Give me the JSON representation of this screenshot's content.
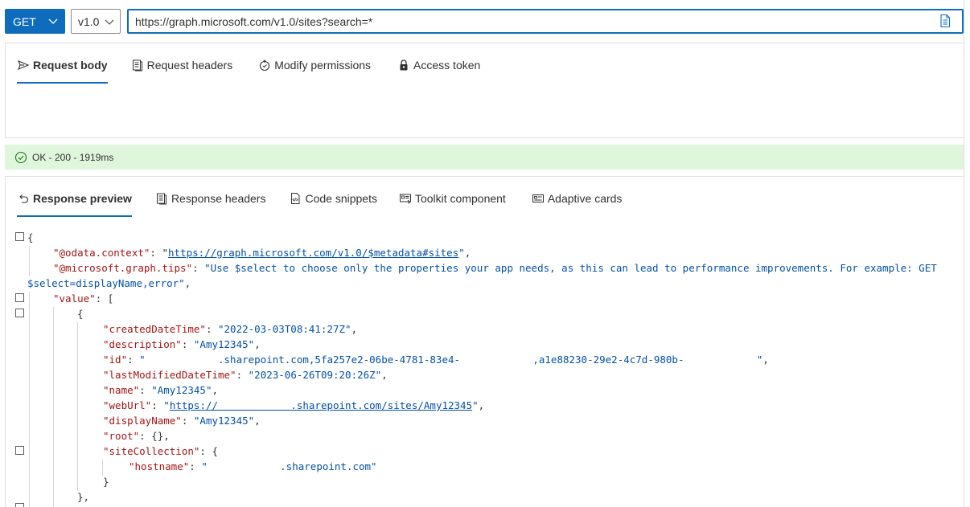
{
  "query": {
    "method": "GET",
    "version": "v1.0",
    "url": "https://graph.microsoft.com/v1.0/sites?search=*"
  },
  "request_tabs": [
    {
      "label": "Request body",
      "icon": "send-icon",
      "active": true
    },
    {
      "label": "Request headers",
      "icon": "headers-icon",
      "active": false
    },
    {
      "label": "Modify permissions",
      "icon": "shield-icon",
      "active": false
    },
    {
      "label": "Access token",
      "icon": "lock-icon",
      "active": false
    }
  ],
  "status": {
    "text": "OK - 200 - 1919ms",
    "color": "#dff6dd"
  },
  "response_tabs": [
    {
      "label": "Response preview",
      "icon": "undo-arrow-icon",
      "active": true
    },
    {
      "label": "Response headers",
      "icon": "headers-icon",
      "active": false
    },
    {
      "label": "Code snippets",
      "icon": "code-file-icon",
      "active": false
    },
    {
      "label": "Toolkit component",
      "icon": "toolkit-icon",
      "active": false
    },
    {
      "label": "Adaptive cards",
      "icon": "card-icon",
      "active": false
    }
  ],
  "json": {
    "open_brace": "{",
    "odata_context_key": "\"@odata.context\"",
    "odata_context_val": "https://graph.microsoft.com/v1.0/$metadata#sites",
    "tips_key": "\"@microsoft.graph.tips\"",
    "tips_val_1": "\"Use $select to choose only the properties your app needs, as this can lead to performance improvements. For example: GET",
    "tips_val_2": "$select=displayName,error\"",
    "value_key": "\"value\"",
    "item_open": "{",
    "createdDateTime_key": "\"createdDateTime\"",
    "createdDateTime_val": "\"2022-03-03T08:41:27Z\"",
    "description_key": "\"description\"",
    "description_val": "\"Amy12345\"",
    "id_key": "\"id\"",
    "id_val": "\"            .sharepoint.com,5fa257e2-06be-4781-83e4-            ,a1e88230-29e2-4c7d-980b-            \"",
    "lastModified_key": "\"lastModifiedDateTime\"",
    "lastModified_val": "\"2023-06-26T09:20:26Z\"",
    "name_key": "\"name\"",
    "name_val": "\"Amy12345\"",
    "webUrl_key": "\"webUrl\"",
    "webUrl_val": "https://            .sharepoint.com/sites/Amy12345",
    "displayName_key": "\"displayName\"",
    "displayName_val": "\"Amy12345\"",
    "root_key": "\"root\"",
    "root_val": "{}",
    "siteCollection_key": "\"siteCollection\"",
    "hostname_key": "\"hostname\"",
    "hostname_val": "\"            .sharepoint.com\"",
    "inner_close": "}",
    "item_close": "},"
  }
}
